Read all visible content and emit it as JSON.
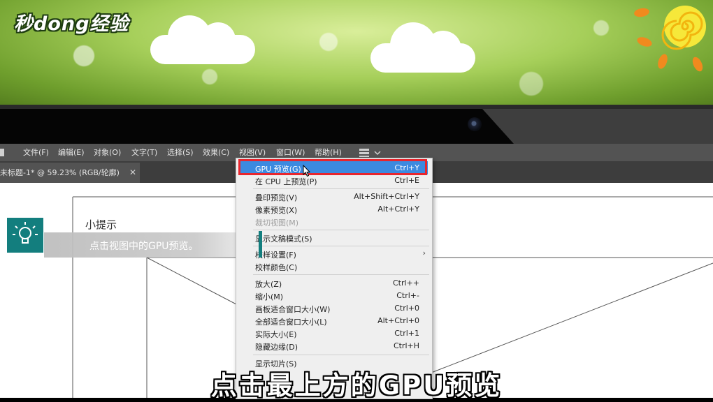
{
  "banner": {
    "logo_text": "秒dong经验"
  },
  "menubar": {
    "items": [
      "文件(F)",
      "编辑(E)",
      "对象(O)",
      "文字(T)",
      "选择(S)",
      "效果(C)",
      "视图(V)",
      "窗口(W)",
      "帮助(H)"
    ]
  },
  "tab": {
    "label": "未标题-1* @ 59.23% (RGB/轮廓)",
    "close": "✕"
  },
  "tip": {
    "title": "小提示",
    "text": "点击视图中的GPU预览。"
  },
  "view_menu": {
    "items": [
      {
        "label": "GPU 预览(G)",
        "shortcut": "Ctrl+Y",
        "highlighted": true
      },
      {
        "label": "在 CPU 上预览(P)",
        "shortcut": "Ctrl+E"
      },
      {
        "label": "叠印预览(V)",
        "shortcut": "Alt+Shift+Ctrl+Y"
      },
      {
        "label": "像素预览(X)",
        "shortcut": "Alt+Ctrl+Y"
      },
      {
        "label": "裁切视图(M)",
        "shortcut": "",
        "disabled": true
      },
      {
        "label": "显示文稿模式(S)",
        "shortcut": ""
      },
      {
        "label": "校样设置(F)",
        "shortcut": "",
        "submenu": true
      },
      {
        "label": "校样颜色(C)",
        "shortcut": ""
      },
      {
        "label": "放大(Z)",
        "shortcut": "Ctrl++"
      },
      {
        "label": "缩小(M)",
        "shortcut": "Ctrl+-"
      },
      {
        "label": "画板适合窗口大小(W)",
        "shortcut": "Ctrl+0"
      },
      {
        "label": "全部适合窗口大小(L)",
        "shortcut": "Alt+Ctrl+0"
      },
      {
        "label": "实际大小(E)",
        "shortcut": "Ctrl+1"
      },
      {
        "label": "隐藏边缘(D)",
        "shortcut": "Ctrl+H"
      },
      {
        "label": "显示切片(S)",
        "shortcut": ""
      }
    ]
  },
  "subtitle": "点击最上方的GPU预览",
  "colors": {
    "menu_highlight": "#3c8ae0",
    "annotation_red": "#e8262e",
    "tip_teal": "#137e7e",
    "menubar_bg": "#535353"
  }
}
